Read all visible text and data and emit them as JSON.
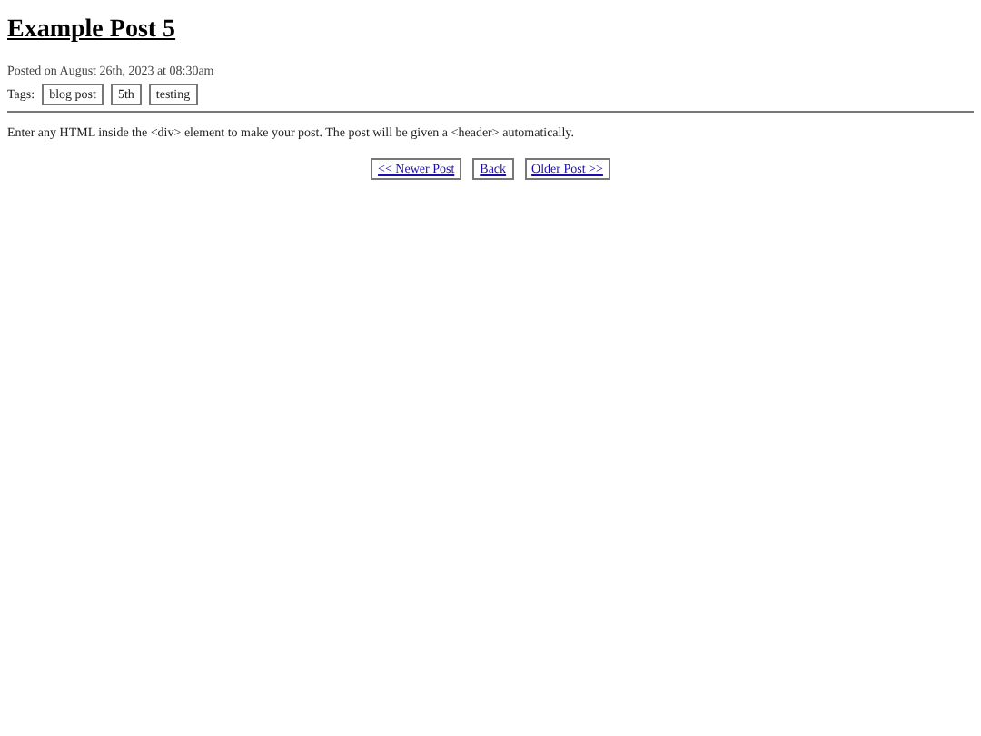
{
  "title": "Example Post 5",
  "posted": "Posted on August 26th, 2023 at 08:30am",
  "tags_label": "Tags:",
  "tags": [
    "blog post",
    "5th",
    "testing"
  ],
  "body": "Enter any HTML inside the <div> element to make your post. The post will be given a <header> automatically.",
  "nav": [
    "<< Newer Post",
    "Back",
    "Older Post >>"
  ]
}
